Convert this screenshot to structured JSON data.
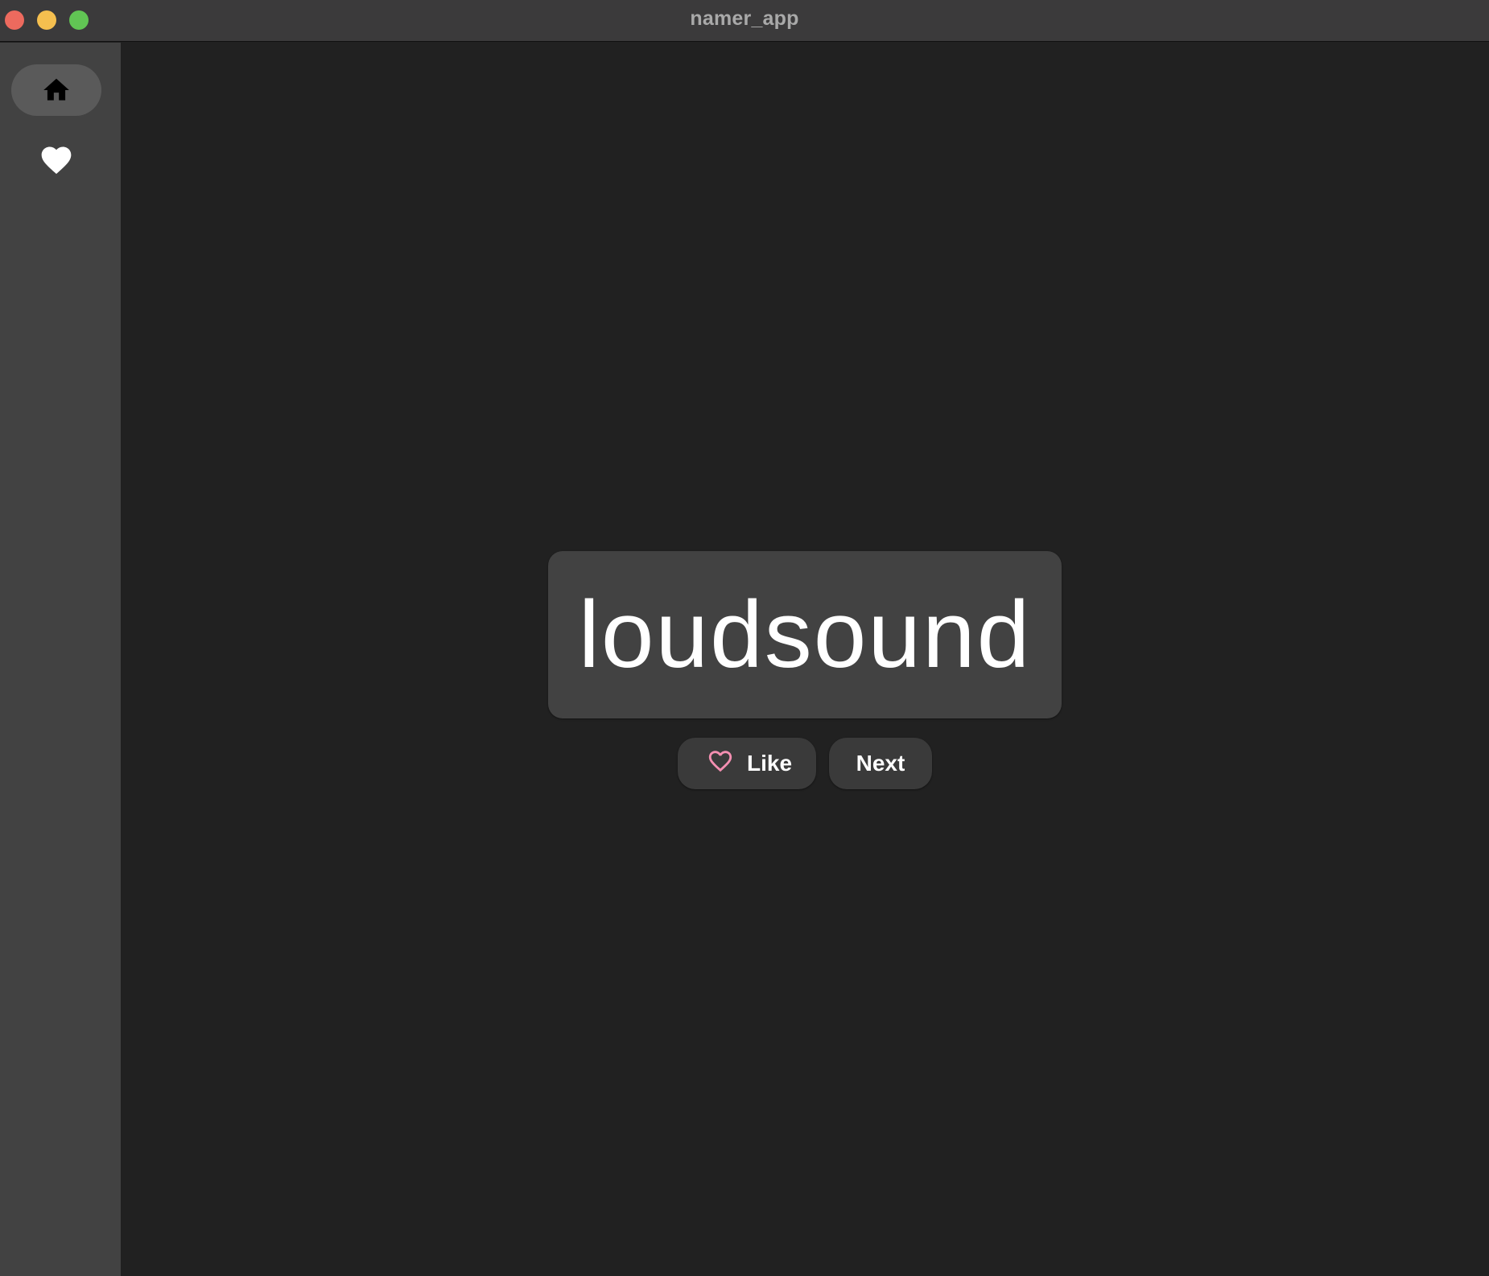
{
  "window": {
    "title": "namer_app"
  },
  "navigation_rail": {
    "items": [
      {
        "icon": "home-icon",
        "selected": true
      },
      {
        "icon": "favorite-icon",
        "selected": false
      }
    ]
  },
  "main": {
    "current_word": "loudsound",
    "like_button": {
      "label": "Like",
      "icon": "favorite-border-icon",
      "icon_color": "#f48fb1"
    },
    "next_button": {
      "label": "Next"
    }
  },
  "colors": {
    "background": "#212121",
    "sidebar": "#424242",
    "card": "#424242",
    "button": "#3a3a3a",
    "selected_indicator": "#5a5a5a"
  }
}
